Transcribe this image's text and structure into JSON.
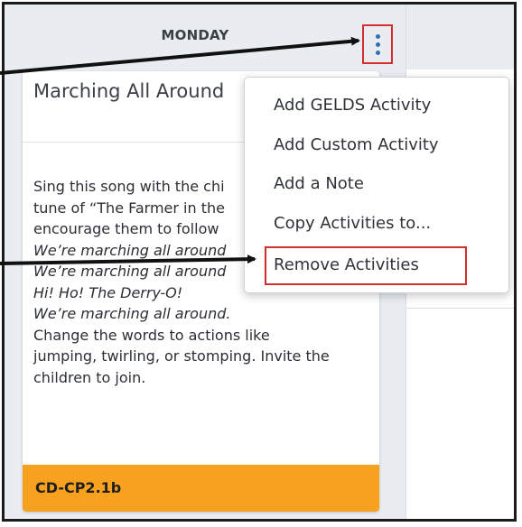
{
  "day_header": "MONDAY",
  "card": {
    "title": "Marching All Around",
    "body_lines": [
      {
        "text": "Sing this song with the chi",
        "italic": false
      },
      {
        "text": "tune of “The Farmer in the",
        "italic": false
      },
      {
        "text": "encourage them to follow",
        "italic": false
      },
      {
        "text": "We’re marching all around",
        "italic": true
      },
      {
        "text": "We’re marching all around",
        "italic": true
      },
      {
        "text": "Hi! Ho! The Derry-O!",
        "italic": true
      },
      {
        "text": "We’re marching all around.",
        "italic": true
      },
      {
        "text": "Change the words to actions like",
        "italic": false
      },
      {
        "text": "jumping, twirling, or stomping. Invite the",
        "italic": false
      },
      {
        "text": "children to join.",
        "italic": false
      }
    ],
    "footer_code": "CD-CP2.1b"
  },
  "menu": {
    "items": [
      "Add GELDS Activity",
      "Add Custom Activity",
      "Add a Note",
      "Copy Activities to...",
      "Remove Activities"
    ]
  },
  "icons": {
    "menu_trigger": "kebab-vertical-icon"
  },
  "colors": {
    "accent_blue": "#2f6fb5",
    "highlight_red": "#d32f2f",
    "footer_orange": "#f7a11e"
  }
}
